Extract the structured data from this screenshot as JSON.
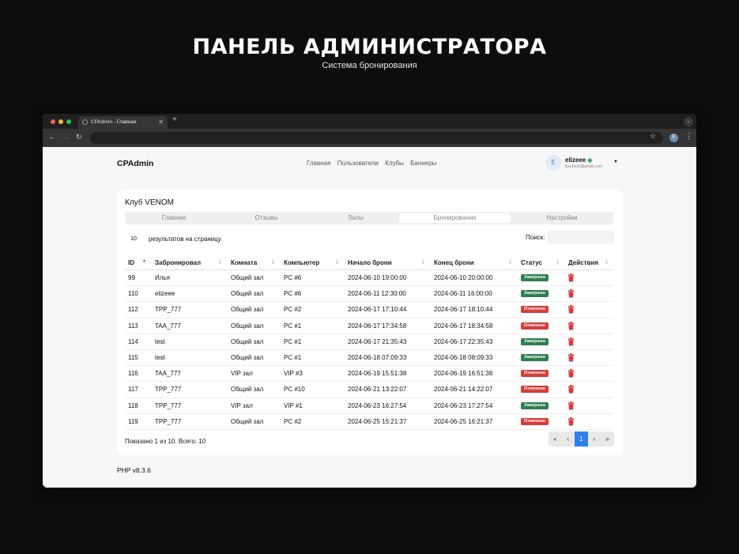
{
  "hero": {
    "title": "ПАНЕЛЬ АДМИНИСТРАТОРА",
    "subtitle": "Система бронирования"
  },
  "browser": {
    "tab_title": "CPAdmin - Главная",
    "icons": {
      "back": "arrow-left-icon",
      "forward": "arrow-right-icon",
      "reload": "reload-icon",
      "star": "star-icon",
      "menu": "kebab-icon"
    },
    "profile_initial": "E"
  },
  "header": {
    "logo": "CPAdmin",
    "nav": [
      "Главная",
      "Пользователи",
      "Клубы",
      "Баннеры"
    ],
    "user": {
      "initial": "E",
      "name": "elizeee",
      "email": "ilya.brick@gmail.com"
    }
  },
  "club": {
    "title": "Клуб VENOM",
    "tabs": [
      "Главная",
      "Отзывы",
      "Залы",
      "Бронирования",
      "Настройки"
    ],
    "active_tab": "Бронирования"
  },
  "table": {
    "per_page": "10",
    "per_page_label": "результатов на страницу",
    "search_label": "Поиск:",
    "columns": [
      "ID",
      "Забронировал",
      "Комната",
      "Компьютер",
      "Начало брони",
      "Конец брони",
      "Статус",
      "Действия"
    ],
    "status_colors": {
      "Завершен": "#2e7d4f",
      "Отменено": "#d63c3c"
    },
    "rows": [
      {
        "id": "99",
        "user": "Илья",
        "room": "Общий зал",
        "pc": "PC #6",
        "start": "2024-06-10 19:00:00",
        "end": "2024-06-10 20:00:00",
        "status": "Завершен"
      },
      {
        "id": "110",
        "user": "elizeee",
        "room": "Общий зал",
        "pc": "PC #6",
        "start": "2024-06-11 12:30:00",
        "end": "2024-06-11 16:00:00",
        "status": "Завершен"
      },
      {
        "id": "112",
        "user": "TPP_777",
        "room": "Общий зал",
        "pc": "PC #2",
        "start": "2024-06-17 17:10:44",
        "end": "2024-06-17 18:10:44",
        "status": "Отменено"
      },
      {
        "id": "113",
        "user": "TAA_777",
        "room": "Общий зал",
        "pc": "PC #1",
        "start": "2024-06-17 17:34:58",
        "end": "2024-06-17 18:34:58",
        "status": "Отменено"
      },
      {
        "id": "114",
        "user": "test",
        "room": "Общий зал",
        "pc": "PC #1",
        "start": "2024-06-17 21:35:43",
        "end": "2024-06-17 22:35:43",
        "status": "Завершен"
      },
      {
        "id": "115",
        "user": "test",
        "room": "Общий зал",
        "pc": "PC #1",
        "start": "2024-06-18 07:09:33",
        "end": "2024-06-18 08:09:33",
        "status": "Завершен"
      },
      {
        "id": "116",
        "user": "TAA_777",
        "room": "VIP зал",
        "pc": "VIP #3",
        "start": "2024-06-19 15:51:38",
        "end": "2024-06-19 16:51:38",
        "status": "Отменено"
      },
      {
        "id": "117",
        "user": "TPP_777",
        "room": "Общий зал",
        "pc": "PC #10",
        "start": "2024-06-21 13:22:07",
        "end": "2024-06-21 14:22:07",
        "status": "Отменено"
      },
      {
        "id": "118",
        "user": "TPP_777",
        "room": "VIP зал",
        "pc": "VIP #1",
        "start": "2024-06-23 16:27:54",
        "end": "2024-06-23 17:27:54",
        "status": "Завершен"
      },
      {
        "id": "119",
        "user": "TPP_777",
        "room": "Общий зал",
        "pc": "PC #2",
        "start": "2024-06-25 15:21:37",
        "end": "2024-06-25 16:21:37",
        "status": "Отменено"
      }
    ],
    "footer_info": "Показано 1 из 10. Всего: 10",
    "pagination": [
      "«",
      "‹",
      "1",
      "›",
      "»"
    ],
    "current_page": "1"
  },
  "footer": {
    "version": "PHP v8.3.6"
  }
}
